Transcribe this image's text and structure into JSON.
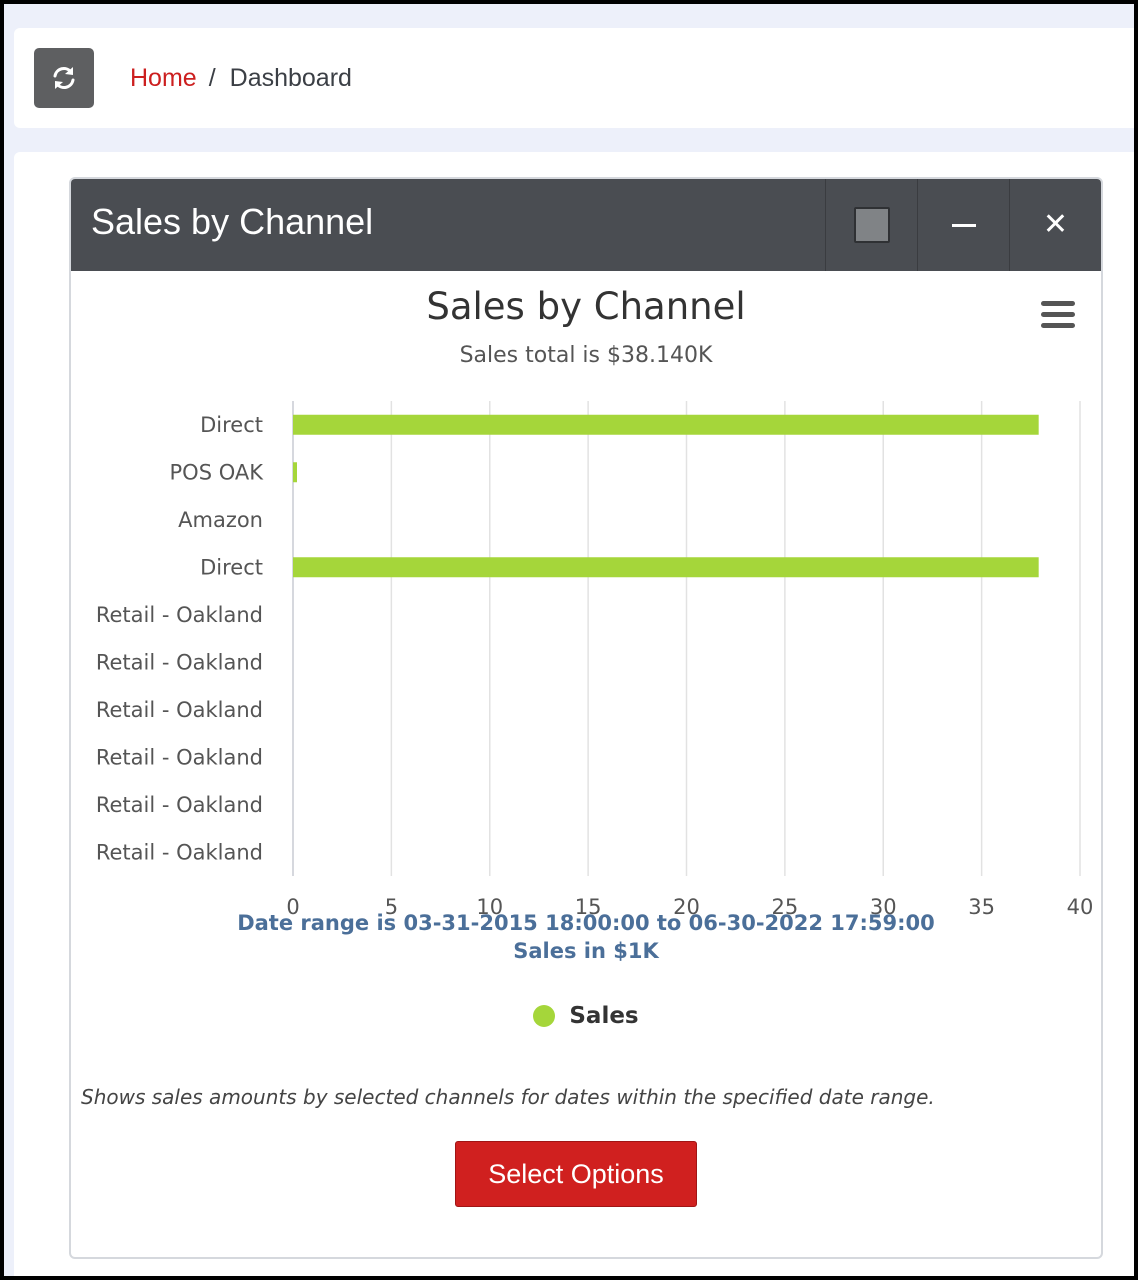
{
  "breadcrumb": {
    "home": "Home",
    "separator": "/",
    "current": "Dashboard"
  },
  "widget": {
    "title": "Sales by Channel",
    "description": "Shows sales amounts by selected channels for dates within the specified date range.",
    "select_options_label": "Select Options"
  },
  "icons": {
    "refresh": "refresh-icon",
    "maximize": "square-icon",
    "minimize": "minus-icon",
    "close": "close-icon",
    "menu": "hamburger-menu-icon"
  },
  "colors": {
    "accent_red": "#cc1f1f",
    "header_bg": "#4a4d52",
    "bar_color": "#a5d63a",
    "caption_blue": "#4b6f99"
  },
  "chart_data": {
    "type": "bar",
    "orientation": "horizontal",
    "title": "Sales by Channel",
    "subtitle": "Sales total is $38.140K",
    "categories": [
      "Direct",
      "POS OAK",
      "Amazon",
      "Direct",
      "Retail - Oakland",
      "Retail - Oakland",
      "Retail - Oakland",
      "Retail - Oakland",
      "Retail - Oakland",
      "Retail - Oakland"
    ],
    "series": [
      {
        "name": "Sales",
        "values": [
          37.9,
          0.2,
          0,
          37.9,
          0,
          0,
          0,
          0,
          0,
          0
        ]
      }
    ],
    "x_ticks": [
      0,
      5,
      10,
      15,
      20,
      25,
      30,
      35,
      40
    ],
    "xlim": [
      0,
      40
    ],
    "xlabel_line1": "Date range is 03-31-2015 18:00:00 to 06-30-2022 17:59:00",
    "xlabel_line2": "Sales in $1K",
    "grid": true,
    "legend": "bottom-center"
  }
}
